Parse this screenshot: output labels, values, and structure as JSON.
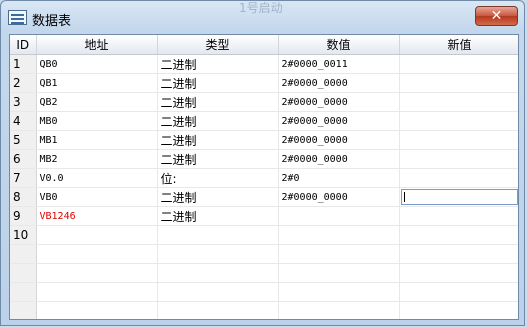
{
  "window": {
    "title": "数据表",
    "background_title": "1号启动",
    "close_label": "✕"
  },
  "table": {
    "columns": [
      "ID",
      "地址",
      "类型",
      "数值",
      "新值"
    ],
    "rows": [
      {
        "id": "1",
        "address": "QB0",
        "type": "二进制",
        "value": "2#0000_0011",
        "new": "",
        "address_color": "normal"
      },
      {
        "id": "2",
        "address": "QB1",
        "type": "二进制",
        "value": "2#0000_0000",
        "new": "",
        "address_color": "normal"
      },
      {
        "id": "3",
        "address": "QB2",
        "type": "二进制",
        "value": "2#0000_0000",
        "new": "",
        "address_color": "normal"
      },
      {
        "id": "4",
        "address": "MB0",
        "type": "二进制",
        "value": "2#0000_0000",
        "new": "",
        "address_color": "normal"
      },
      {
        "id": "5",
        "address": "MB1",
        "type": "二进制",
        "value": "2#0000_0000",
        "new": "",
        "address_color": "normal"
      },
      {
        "id": "6",
        "address": "MB2",
        "type": "二进制",
        "value": "2#0000_0000",
        "new": "",
        "address_color": "normal"
      },
      {
        "id": "7",
        "address": "V0.0",
        "type": "位:",
        "value": "2#0",
        "new": "",
        "address_color": "normal"
      },
      {
        "id": "8",
        "address": "VB0",
        "type": "二进制",
        "value": "2#0000_0000",
        "new": "",
        "address_color": "normal",
        "editing": true
      },
      {
        "id": "9",
        "address": "VB1246",
        "type": "二进制",
        "value": "",
        "new": "",
        "address_color": "error"
      },
      {
        "id": "10",
        "address": "",
        "type": "",
        "value": "",
        "new": "",
        "address_color": "normal"
      }
    ],
    "empty_rows": 4
  },
  "colors": {
    "error_text": "#e00000",
    "header_bg": "#eef1f6",
    "frame": "#c3d7ec"
  }
}
